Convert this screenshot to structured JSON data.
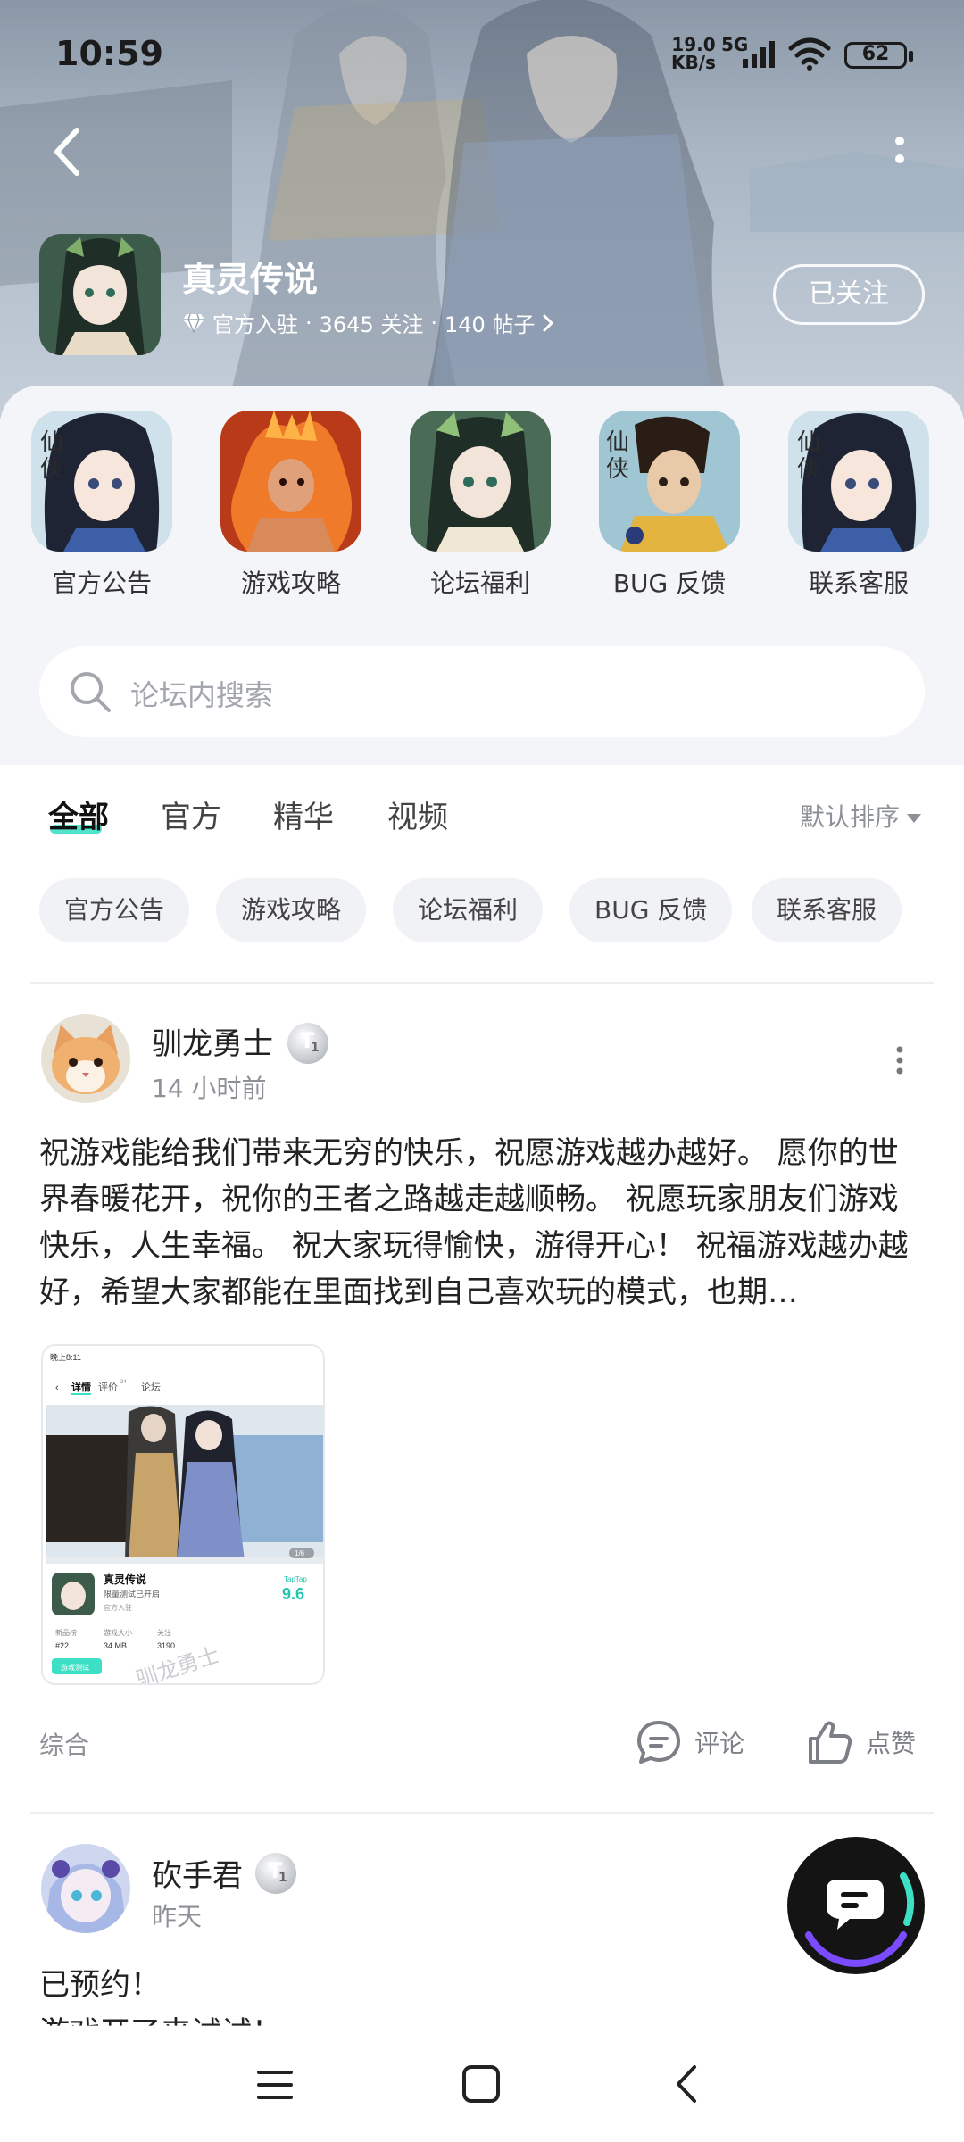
{
  "status_bar": {
    "time": "10:59",
    "net_speed_value": "19.0",
    "net_speed_unit": "KB/s",
    "network": "5G",
    "battery": "62"
  },
  "forum": {
    "title": "真灵传说",
    "badge_text": "官方入驻",
    "followers": "3645 关注",
    "posts": "140 帖子",
    "follow_button": "已关注"
  },
  "shortcuts": [
    {
      "label": "官方公告"
    },
    {
      "label": "游戏攻略"
    },
    {
      "label": "论坛福利"
    },
    {
      "label": "BUG 反馈"
    },
    {
      "label": "联系客服"
    }
  ],
  "search": {
    "placeholder": "论坛内搜索"
  },
  "tabs": [
    {
      "label": "全部",
      "active": true
    },
    {
      "label": "官方"
    },
    {
      "label": "精华"
    },
    {
      "label": "视频"
    }
  ],
  "sort_label": "默认排序",
  "chips": [
    "官方公告",
    "游戏攻略",
    "论坛福利",
    "BUG 反馈",
    "联系客服"
  ],
  "posts": [
    {
      "author": "驯龙勇士",
      "level": "1",
      "time": "14 小时前",
      "text": "祝游戏能给我们带来无穷的快乐，祝愿游戏越办越好。 愿你的世界春暖花开，祝你的王者之路越走越顺畅。 祝愿玩家朋友们游戏快乐，人生幸福。 祝大家玩得愉快，游得开心！ 祝福游戏越办越好，希望大家都能在里面找到自己喜欢玩的模式，也期…",
      "image": {
        "status_time": "晚上8:11",
        "tabs": [
          "详情",
          "评价",
          "论坛"
        ],
        "review_count": "34",
        "game_name": "真灵传说",
        "game_sub": "限量测试已开启",
        "official": "官方入驻",
        "rating_brand": "TapTap",
        "rating": "9.6",
        "page": "1/6",
        "stats": [
          {
            "label": "新品榜",
            "value": "#22"
          },
          {
            "label": "游戏大小",
            "value": "34 MB"
          },
          {
            "label": "关注",
            "value": "3190"
          }
        ],
        "watermark": "驯龙勇士",
        "button": "游戏测试"
      },
      "category": "综合",
      "comment_label": "评论",
      "like_label": "点赞"
    },
    {
      "author": "砍手君",
      "level": "1",
      "time": "昨天",
      "text_line1": "已预约！",
      "text_line2": "游戏开了来试试！"
    }
  ],
  "colors": {
    "accent": "#3ee0c5",
    "hero_bg": "#a9b5c3",
    "panel_bg": "#f4f5f8",
    "chip_bg": "#f1f2f5"
  }
}
